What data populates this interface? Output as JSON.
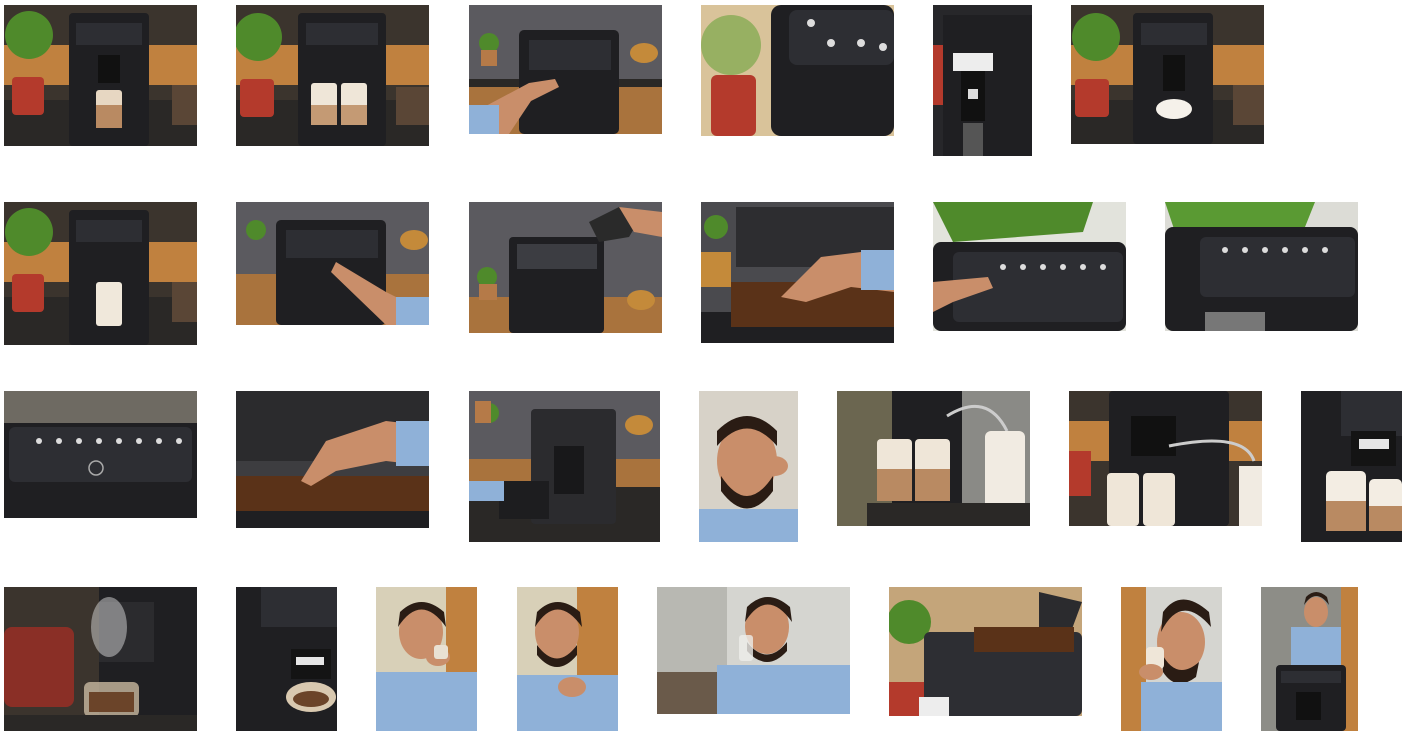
{
  "gallery": {
    "rows": [
      {
        "items": [
          {
            "subject": "machine-latte-glass",
            "scene": "kitchen-plant"
          },
          {
            "subject": "machine-two-glasses",
            "scene": "kitchen-plant"
          },
          {
            "subject": "finger-pressing-button",
            "scene": "kitchen-wide"
          },
          {
            "subject": "control-panel-closeup",
            "scene": "closeup"
          },
          {
            "subject": "milk-spout-closeup",
            "scene": "closeup-tall"
          },
          {
            "subject": "machine-cup-front",
            "scene": "kitchen-plant"
          }
        ]
      },
      {
        "items": [
          {
            "subject": "machine-latte-glass",
            "scene": "kitchen-plant"
          },
          {
            "subject": "finger-pressing-button",
            "scene": "kitchen-wide"
          },
          {
            "subject": "pouring-water-tank",
            "scene": "kitchen-wide"
          },
          {
            "subject": "filling-beans",
            "scene": "closeup"
          },
          {
            "subject": "finger-on-panel",
            "scene": "plant-closeup"
          },
          {
            "subject": "panel-angled",
            "scene": "plant-closeup"
          }
        ]
      },
      {
        "items": [
          {
            "subject": "control-panel-front",
            "scene": "closeup"
          },
          {
            "subject": "hand-in-beans",
            "scene": "closeup"
          },
          {
            "subject": "removing-brew-unit",
            "scene": "kitchen-wide"
          },
          {
            "subject": "man-holding-bean",
            "scene": "portrait"
          },
          {
            "subject": "milk-carafe-glasses",
            "scene": "closeup"
          },
          {
            "subject": "machine-three-glasses",
            "scene": "kitchen-plant"
          },
          {
            "subject": "cappuccino-cups-spout",
            "scene": "closeup"
          }
        ]
      },
      {
        "items": [
          {
            "subject": "steaming-espresso",
            "scene": "closeup"
          },
          {
            "subject": "spout-glass-cup",
            "scene": "closeup-tall"
          },
          {
            "subject": "man-drinking-coffee",
            "scene": "portrait"
          },
          {
            "subject": "man-smelling-coffee",
            "scene": "portrait"
          },
          {
            "subject": "man-drinking-water-glass",
            "scene": "portrait-wide"
          },
          {
            "subject": "bean-hopper-open",
            "scene": "plant-closeup"
          },
          {
            "subject": "man-sipping-profile",
            "scene": "portrait"
          },
          {
            "subject": "man-using-machine",
            "scene": "portrait"
          }
        ]
      }
    ]
  },
  "colors": {
    "machine": "#1f1f22",
    "panel": "#2d2e33",
    "wood": "#a9733d",
    "counter": "#2a2826",
    "plant": "#4f8a2b",
    "pot": "#b43a2c",
    "milk": "#f1ebe2",
    "coffee": "#6b4429",
    "skin": "#c98e6a",
    "shirt": "#8fb1d8",
    "wall": "#d7d2c8",
    "beans": "#5a3218"
  }
}
